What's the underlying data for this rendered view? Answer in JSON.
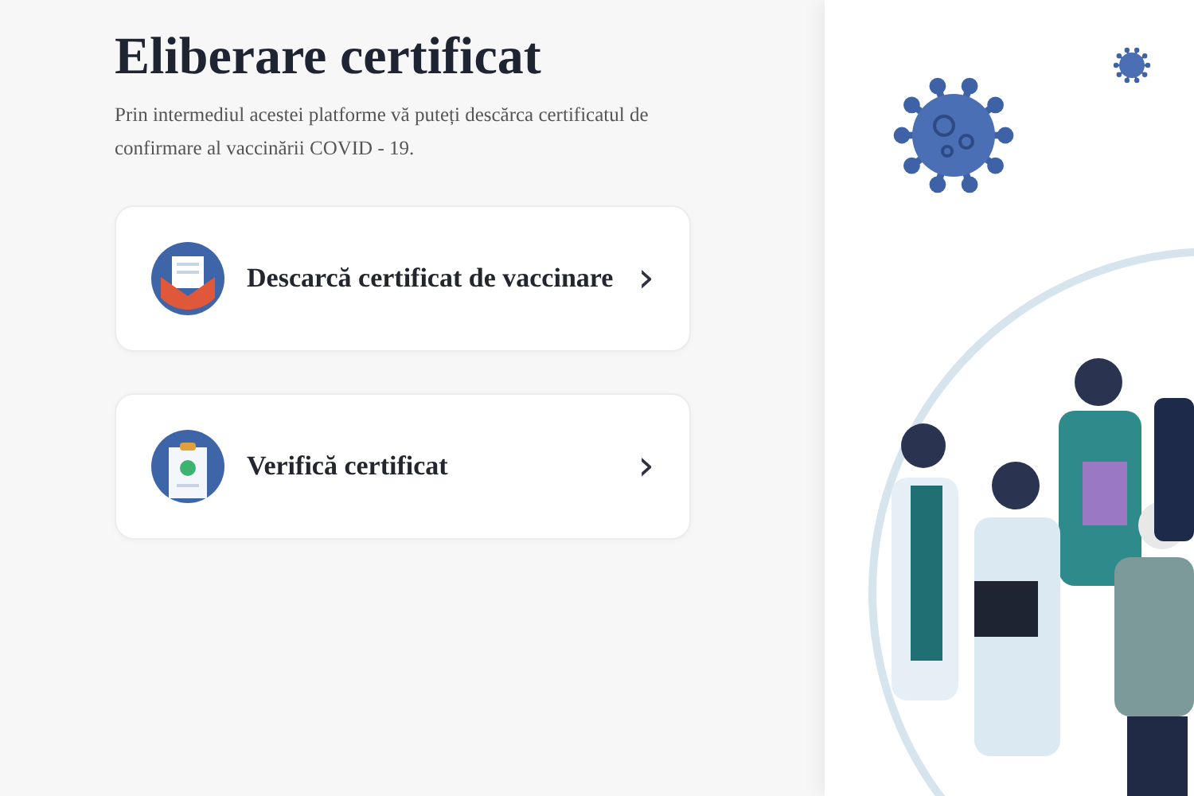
{
  "page": {
    "title": "Eliberare certificat",
    "description": "Prin intermediul acestei platforme vă puteți descărca certificatul de confirmare al vaccinării COVID - 19."
  },
  "actions": [
    {
      "label": "Descarcă certificat de vaccinare",
      "kind": "download",
      "chevron": "›"
    },
    {
      "label": "Verifică certificat",
      "kind": "verify",
      "chevron": "›"
    }
  ]
}
